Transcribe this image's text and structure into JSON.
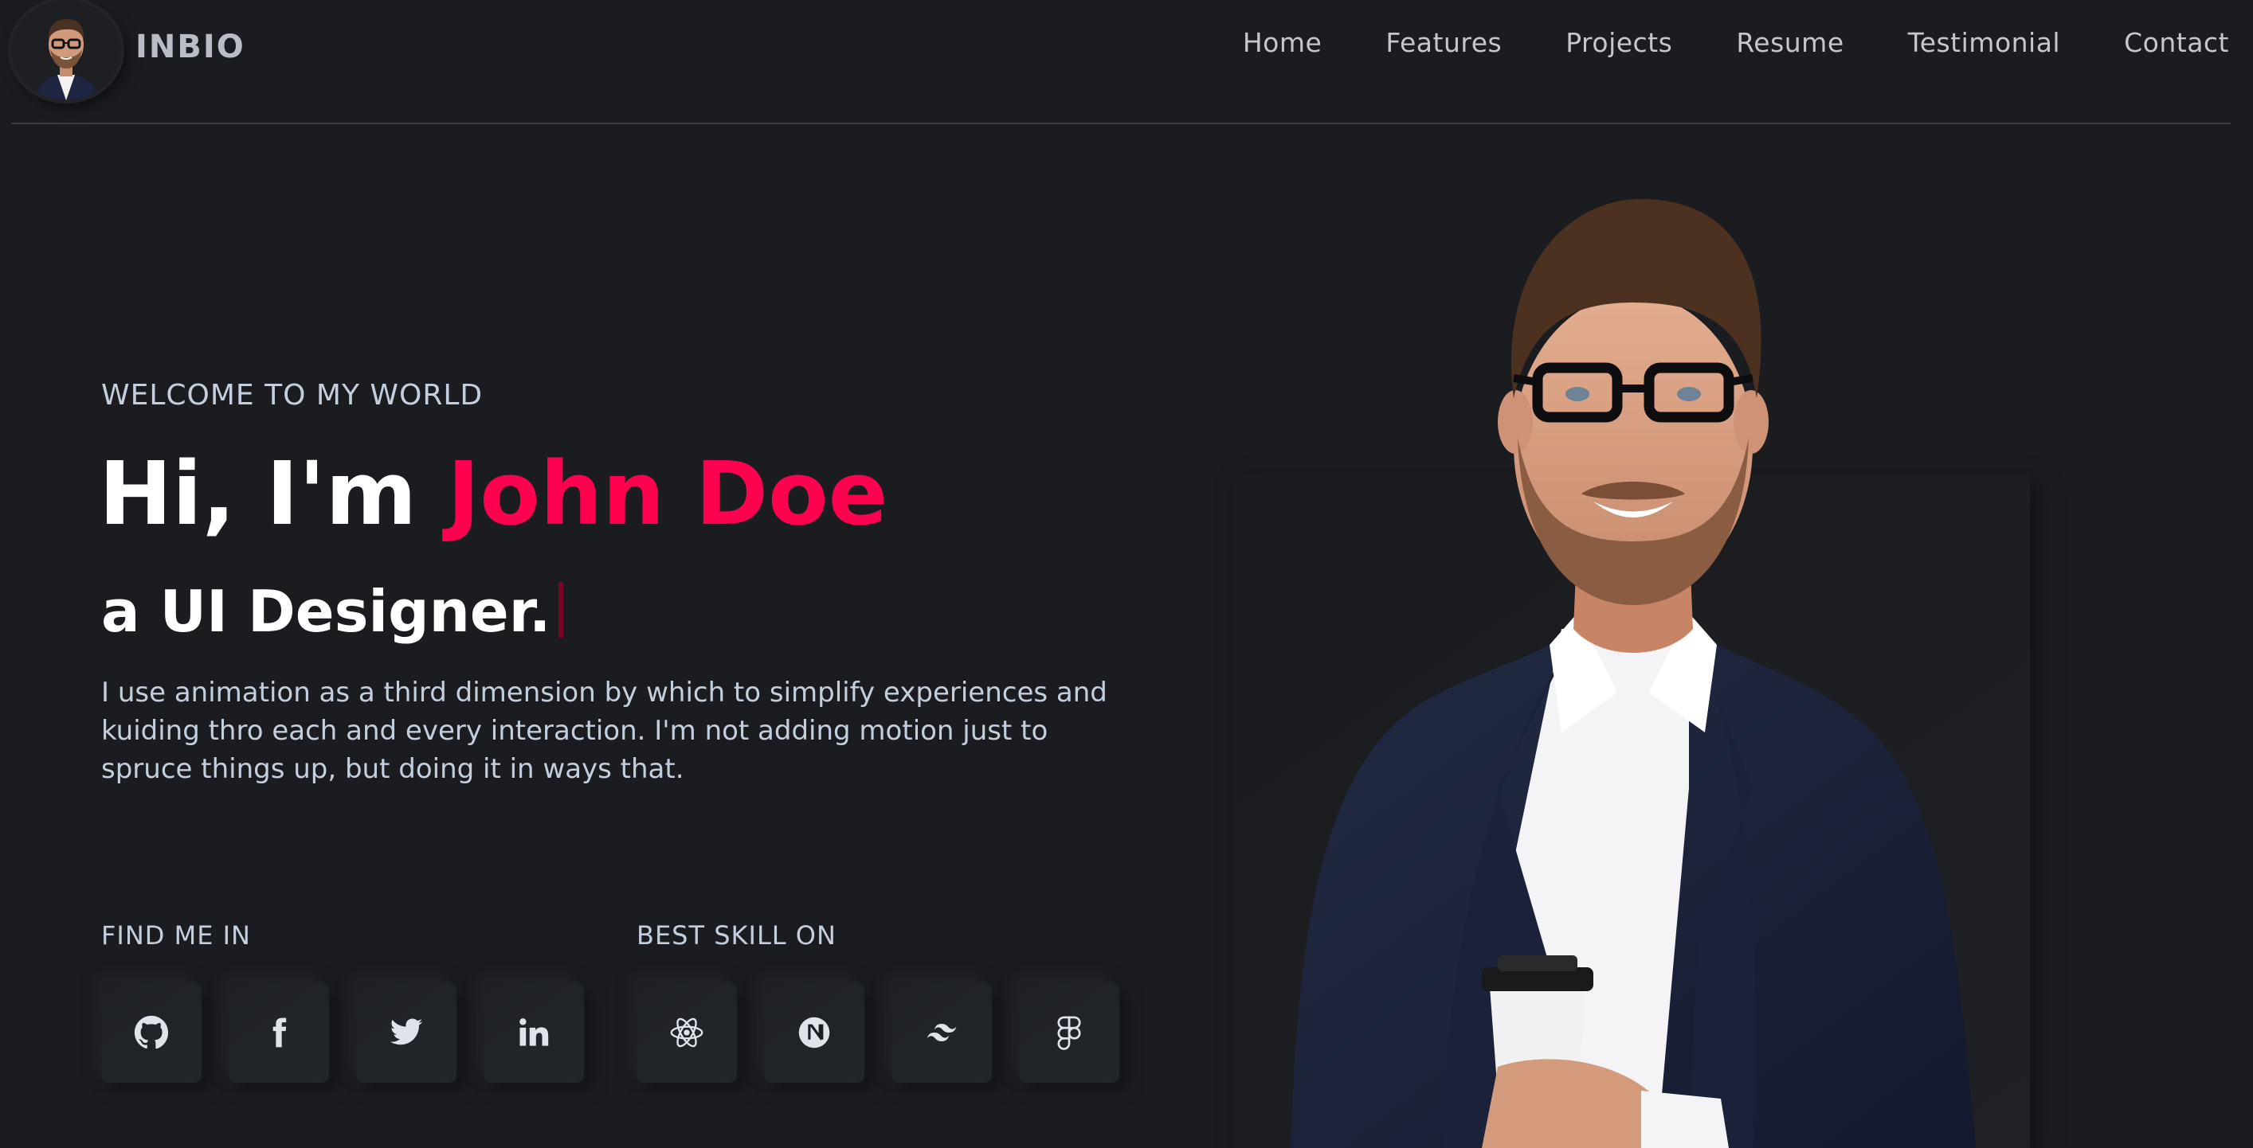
{
  "header": {
    "brand": "INBIO",
    "nav": [
      {
        "label": "Home"
      },
      {
        "label": "Features"
      },
      {
        "label": "Projects"
      },
      {
        "label": "Resume"
      },
      {
        "label": "Testimonial"
      },
      {
        "label": "Contact"
      }
    ]
  },
  "hero": {
    "welcome": "WELCOME TO MY WORLD",
    "greeting": "Hi, I'm ",
    "name": "John Doe",
    "role": "a UI Designer.",
    "description": "I use animation as a third dimension by which to simplify experiences and kuiding thro each and every interaction. I'm not adding motion just to spruce things up, but doing it in ways that."
  },
  "find_me": {
    "title": "FIND ME IN",
    "icons": [
      "github-icon",
      "facebook-icon",
      "twitter-icon",
      "linkedin-icon"
    ]
  },
  "skills": {
    "title": "BEST SKILL ON",
    "icons": [
      "react-icon",
      "nextjs-icon",
      "tailwind-icon",
      "figma-icon"
    ]
  },
  "colors": {
    "background": "#1b1c20",
    "accent": "#ff014f",
    "text_muted": "#c4cfde",
    "white": "#ffffff"
  }
}
